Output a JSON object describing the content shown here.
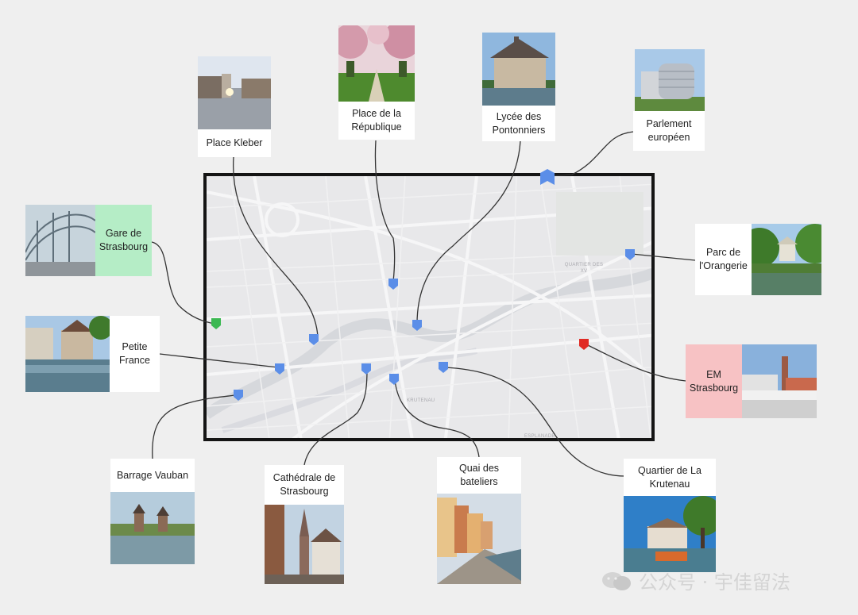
{
  "places": [
    {
      "id": "place-kleber",
      "name": "Place Kleber"
    },
    {
      "id": "place-republique",
      "name": "Place de la République"
    },
    {
      "id": "lycee",
      "name": "Lycée des Pontonniers"
    },
    {
      "id": "parlement",
      "name": "Parlement européen"
    },
    {
      "id": "gare",
      "name": "Gare de Strasbourg"
    },
    {
      "id": "orangerie",
      "name": "Parc de l'Orangerie"
    },
    {
      "id": "petite-france",
      "name": "Petite France"
    },
    {
      "id": "em",
      "name": "EM Strasbourg"
    },
    {
      "id": "vauban",
      "name": "Barrage Vauban"
    },
    {
      "id": "cathedrale",
      "name": "Cathédrale de Strasbourg"
    },
    {
      "id": "quai",
      "name": "Quai des bateliers"
    },
    {
      "id": "krutenau",
      "name": "Quartier de La Krutenau"
    }
  ],
  "map_labels": {
    "quartier_xv": "QUARTIER DES XV",
    "krutenau": "KRUTENAU",
    "esplanade": "ESPLANADE"
  },
  "colors": {
    "pin_default": "#5b8ee8",
    "pin_gare": "#3cb852",
    "pin_em": "#e02a24",
    "gare_label_bg": "#b5edc6",
    "em_label_bg": "#f7c2c4",
    "frame": "#141414"
  },
  "watermark": "公众号 · 宇佳留法"
}
